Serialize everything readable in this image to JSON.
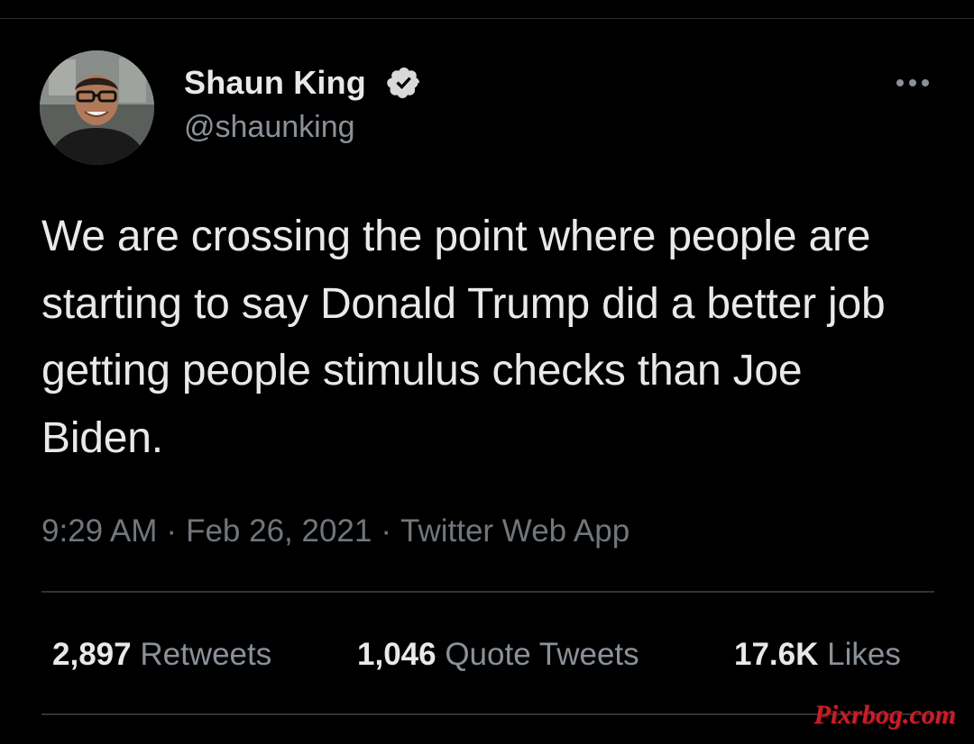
{
  "tweet": {
    "display_name": "Shaun King",
    "handle": "@shaunking",
    "text": "We are crossing the point where people are starting to say Donald Trump did a better job getting people stimulus checks than Joe Biden.",
    "time": "9:29 AM",
    "separator": "·",
    "date": "Feb 26, 2021",
    "source": "Twitter Web App"
  },
  "stats": {
    "retweets_count": "2,897",
    "retweets_label": "Retweets",
    "quotes_count": "1,046",
    "quotes_label": "Quote Tweets",
    "likes_count": "17.6K",
    "likes_label": "Likes"
  },
  "watermark": "Pixrbog.com",
  "icons": {
    "verified": "verified-badge-icon",
    "more": "more-options-icon"
  },
  "colors": {
    "background": "#000000",
    "primary_text": "#e7e9ea",
    "secondary_text": "#8b9198",
    "watermark": "#c81e28"
  }
}
